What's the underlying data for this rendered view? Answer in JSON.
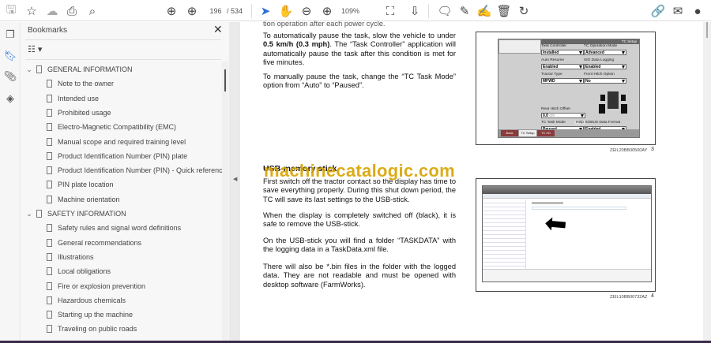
{
  "toolbar": {
    "page_current": "196",
    "page_total": "/ 534",
    "zoom": "109%"
  },
  "panel": {
    "title": "Bookmarks",
    "close": "✕"
  },
  "bookmarks": [
    {
      "label": "GENERAL INFORMATION",
      "level": 0
    },
    {
      "label": "Note to the owner",
      "level": 1
    },
    {
      "label": "Intended use",
      "level": 1
    },
    {
      "label": "Prohibited usage",
      "level": 1
    },
    {
      "label": "Electro-Magnetic Compatibility (EMC)",
      "level": 1
    },
    {
      "label": "Manual scope and required training level",
      "level": 1
    },
    {
      "label": "Product Identification Number (PIN) plate",
      "level": 1
    },
    {
      "label": "Product Identification Number (PIN) - Quick reference",
      "level": 1
    },
    {
      "label": "PIN plate location",
      "level": 1
    },
    {
      "label": "Machine orientation",
      "level": 1
    },
    {
      "label": "SAFETY INFORMATION",
      "level": 0
    },
    {
      "label": "Safety rules and signal word definitions",
      "level": 1
    },
    {
      "label": "General recommendations",
      "level": 1
    },
    {
      "label": "Illustrations",
      "level": 1
    },
    {
      "label": "Local obligations",
      "level": 1
    },
    {
      "label": "Fire or explosion prevention",
      "level": 1
    },
    {
      "label": "Hazardous chemicals",
      "level": 1
    },
    {
      "label": "Starting up the machine",
      "level": 1
    },
    {
      "label": "Traveling on public roads",
      "level": 1
    }
  ],
  "document": {
    "top_cut": "tion operation after each power cycle.",
    "p1_pre": "To automatically pause the task, slow the vehicle to under ",
    "p1_bold": "0.5 km/h (0.3 mph)",
    "p1_post": ". The “Task Controller” application will automatically pause the task after this condition is met for five minutes.",
    "p2": "To manually pause the task, change the “TC Task Mode” option from “Auto” to “Paused”.",
    "heading": "USB-memory stick",
    "p3": "First switch off the tractor contact so the display has time to save everything properly. During this shut down period, the TC will save its last settings to the USB-stick.",
    "p4": "When the display is completely switched off (black), it is safe to remove the USB-stick.",
    "p5": "On the USB-stick you will find a folder “TASKDATA” with the logging data in a TaskData.xml file.",
    "p6": "There will also be *.bin files in the folder with the logged data.  They are not readable and must be opened with desktop software (FarmWorks).",
    "watermark": "machinecatalogic.com"
  },
  "figure3": {
    "caption": "ZEIL20BB00500AY",
    "number": "3",
    "header": "TC Setup",
    "fields": [
      {
        "label": "Task Controller",
        "value": "Installed"
      },
      {
        "label": "TC Operation Mode",
        "value": "Advanced"
      },
      {
        "label": "Auto Resume",
        "value": "Enabled"
      },
      {
        "label": "ISO Data Logging",
        "value": "Enabled"
      },
      {
        "label": "Tractor Type",
        "value": "MFWD"
      },
      {
        "label": "Front Hitch Option",
        "value": "No"
      },
      {
        "label": "TC Task Mode",
        "value": "Paused"
      },
      {
        "label": "ISOBUS Data Format",
        "value": "Enabled"
      }
    ],
    "rear_hitch_label": "Rear Hitch Offset",
    "rear_hitch_value": "0.0",
    "rear_hitch_unit": "cm",
    "help": "Help",
    "buttons": [
      "Back",
      "TC Setup",
      "TC I/O"
    ]
  },
  "figure4": {
    "caption": "ZEIL10BB00732AZ",
    "number": "4"
  }
}
